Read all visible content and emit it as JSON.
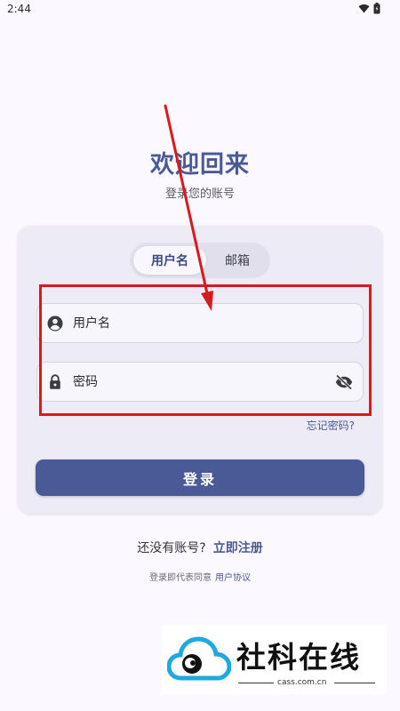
{
  "status_bar": {
    "time": "2:44",
    "icons": [
      "wifi-icon",
      "battery-icon"
    ]
  },
  "header": {
    "title": "欢迎回来",
    "subtitle": "登录您的账号"
  },
  "login_tabs": {
    "items": [
      {
        "label": "用户名",
        "active": true
      },
      {
        "label": "邮箱",
        "active": false
      }
    ]
  },
  "form": {
    "username": {
      "value": "",
      "placeholder": "用户名",
      "icon": "account-circle-icon"
    },
    "password": {
      "value": "",
      "placeholder": "密码",
      "icon": "lock-icon",
      "toggle_icon": "eye-off-icon"
    },
    "forgot_label": "忘记密码?",
    "submit_label": "登录"
  },
  "register": {
    "prompt": "还没有账号?",
    "link_label": "立即注册"
  },
  "agreement": {
    "prefix": "登录即代表同意",
    "link_label": "用户协议"
  },
  "watermark": {
    "name": "社科在线",
    "domain": "cass.com.cn"
  },
  "colors": {
    "accent": "#4a5a96",
    "background": "#fbf9ff",
    "card": "#ecebf6",
    "annotation": "#d81a1a"
  }
}
